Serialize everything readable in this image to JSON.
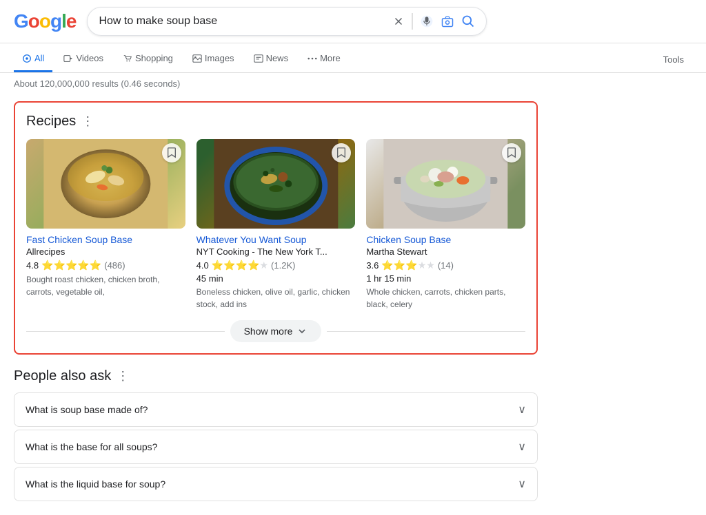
{
  "search": {
    "query": "How to make soup base",
    "clear_label": "×",
    "placeholder": "How to make soup base"
  },
  "nav": {
    "items": [
      {
        "label": "All",
        "icon": "🔍",
        "active": true
      },
      {
        "label": "Videos",
        "icon": "▶",
        "active": false
      },
      {
        "label": "Shopping",
        "icon": "🛍",
        "active": false
      },
      {
        "label": "Images",
        "icon": "🖼",
        "active": false
      },
      {
        "label": "News",
        "icon": "📰",
        "active": false
      },
      {
        "label": "More",
        "icon": "⋮",
        "active": false
      }
    ],
    "tools_label": "Tools"
  },
  "results_info": "About 120,000,000 results (0.46 seconds)",
  "recipes": {
    "title": "Recipes",
    "show_more_label": "Show more",
    "items": [
      {
        "name": "Fast Chicken Soup Base",
        "source": "Allrecipes",
        "rating": "4.8",
        "rating_count": "(486)",
        "stars_full": 5,
        "stars_empty": 0,
        "time": "",
        "ingredients": "Bought roast chicken, chicken broth, carrots, vegetable oil,",
        "img_class": "recipe-img-1"
      },
      {
        "name": "Whatever You Want Soup",
        "source": "NYT Cooking - The New York T...",
        "rating": "4.0",
        "rating_count": "(1.2K)",
        "stars_full": 4,
        "stars_empty": 1,
        "time": "45 min",
        "ingredients": "Boneless chicken, olive oil, garlic, chicken stock, add ins",
        "img_class": "recipe-img-2"
      },
      {
        "name": "Chicken Soup Base",
        "source": "Martha Stewart",
        "rating": "3.6",
        "rating_count": "(14)",
        "stars_full": 3,
        "stars_empty": 2,
        "time": "1 hr 15 min",
        "ingredients": "Whole chicken, carrots, chicken parts, black, celery",
        "img_class": "recipe-img-3"
      }
    ]
  },
  "people_also_ask": {
    "title": "People also ask",
    "questions": [
      {
        "text": "What is soup base made of?"
      },
      {
        "text": "What is the base for all soups?"
      },
      {
        "text": "What is the liquid base for soup?"
      }
    ]
  }
}
